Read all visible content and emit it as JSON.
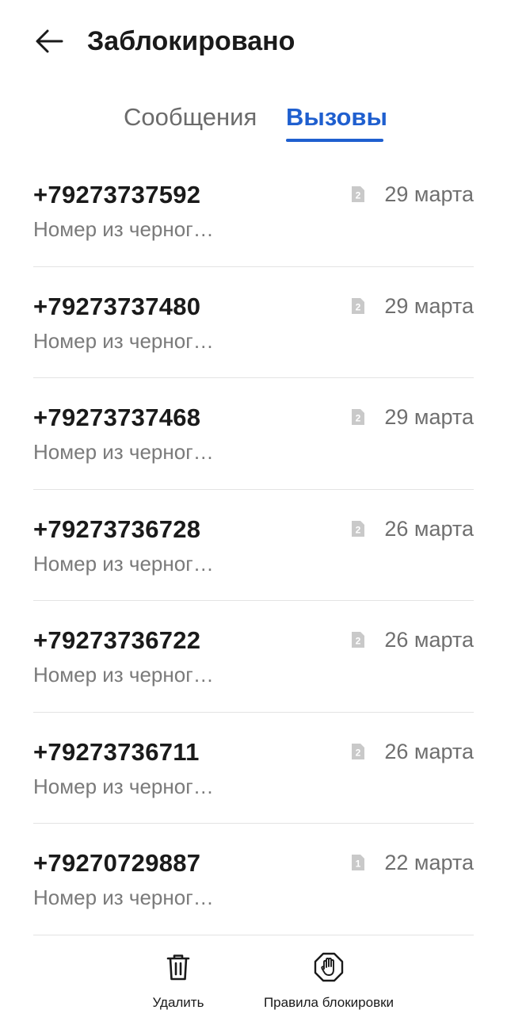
{
  "header": {
    "title": "Заблокировано",
    "back_icon": "arrow-left-icon"
  },
  "tabs": [
    {
      "label": "Сообщения",
      "active": false
    },
    {
      "label": "Вызовы",
      "active": true
    }
  ],
  "accent_color": "#1f5fcf",
  "calls": [
    {
      "number": "+79273737592",
      "subtitle": "Номер из черног…",
      "sim": "2",
      "date": "29 марта"
    },
    {
      "number": "+79273737480",
      "subtitle": "Номер из черног…",
      "sim": "2",
      "date": "29 марта"
    },
    {
      "number": "+79273737468",
      "subtitle": "Номер из черног…",
      "sim": "2",
      "date": "29 марта"
    },
    {
      "number": "+79273736728",
      "subtitle": "Номер из черног…",
      "sim": "2",
      "date": "26 марта"
    },
    {
      "number": "+79273736722",
      "subtitle": "Номер из черног…",
      "sim": "2",
      "date": "26 марта"
    },
    {
      "number": "+79273736711",
      "subtitle": "Номер из черног…",
      "sim": "2",
      "date": "26 марта"
    },
    {
      "number": "+79270729887",
      "subtitle": "Номер из черног…",
      "sim": "1",
      "date": "22 марта"
    }
  ],
  "bottom_bar": {
    "delete": {
      "label": "Удалить",
      "icon": "trash-icon"
    },
    "rules": {
      "label": "Правила блокировки",
      "icon": "hand-stop-icon"
    }
  }
}
